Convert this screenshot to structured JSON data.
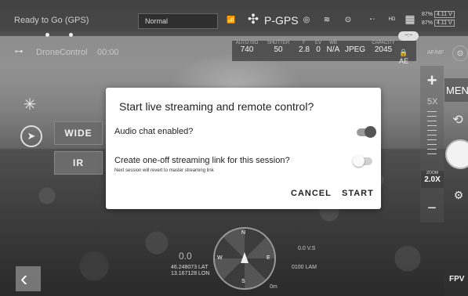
{
  "status": {
    "ready_text": "Ready to Go (GPS)",
    "mode": "Normal",
    "flight_mode": "P-GPS",
    "battery_top": "87%",
    "battery_top_v": "4.11 V",
    "battery_bottom": "87%",
    "battery_bottom_v": "4.11 V"
  },
  "app": {
    "name": "DroneControl",
    "timer": "00:00"
  },
  "camera": {
    "auto_label": "AUTO",
    "iso_label": "ISO",
    "shutter_label": "SHUTTER",
    "f_label": "F",
    "ev_label": "EV",
    "wb_label": "WB",
    "capacity_label": "CAPACITY",
    "iso": "740",
    "shutter": "50",
    "f": "2.8",
    "ev": "0",
    "wb": "N/A",
    "format": "JPEG",
    "capacity": "2045",
    "ae": "AE",
    "af_mf": "AF/MF"
  },
  "left_buttons": {
    "wide": "WIDE",
    "ir": "IR"
  },
  "right_panel": {
    "zoom_level": "5X",
    "zoom_label": "ZOOM",
    "zoom_value": "2.0X",
    "menu": "MENU",
    "fpv": "FPV"
  },
  "dialog": {
    "title": "Start live streaming and remote control?",
    "audio_label": "Audio chat enabled?",
    "audio_on": true,
    "link_label": "Create one-off streaming link for this session?",
    "link_note": "Next session will revert to master streaming link",
    "link_on": false,
    "cancel": "CANCEL",
    "start": "START"
  },
  "telemetry": {
    "lat": "46.248073 LAT",
    "lon": "13.167128 LON",
    "speed": "0.0",
    "height_unit": "0.0 V.S",
    "alt": "0100 LAM",
    "dist_unit": "0m"
  },
  "compass_marks": [
    "N",
    "E",
    "S",
    "W"
  ]
}
